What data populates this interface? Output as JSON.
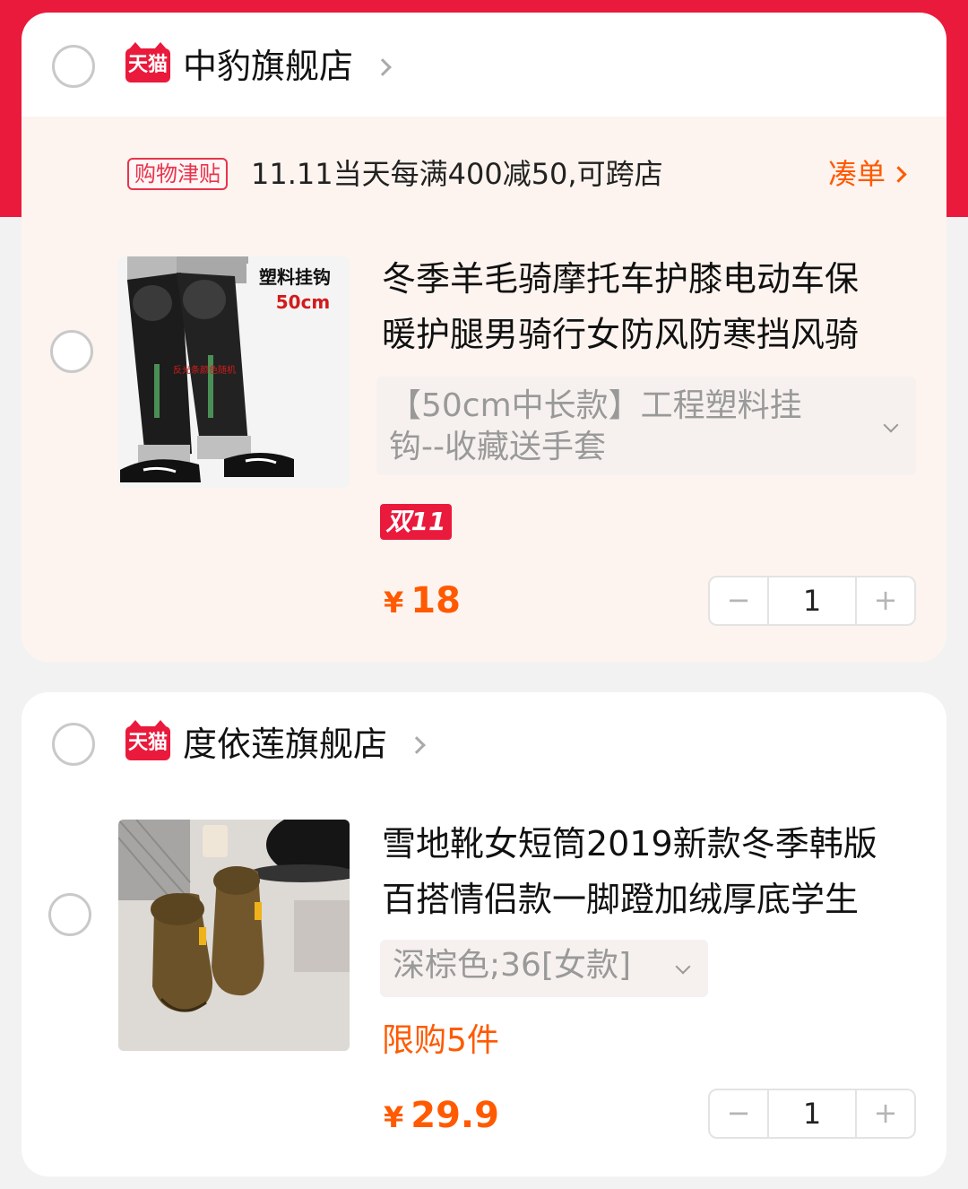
{
  "stores": [
    {
      "badge": "天猫",
      "name": "中豹旗舰店",
      "promo": {
        "tag": "购物津贴",
        "text": "11.11当天每满400减50,可跨店",
        "link": "凑单"
      },
      "item": {
        "title_line1": "冬季羊毛骑摩托车护膝电动车保",
        "title_line2": "暖护腿男骑行女防风防寒挡风骑",
        "sku": "【50cm中长款】工程塑料挂钩--收藏送手套",
        "image_caption_1": "塑料挂钩",
        "image_caption_2": "50cm",
        "image_caption_3": "反光条颜色随机",
        "event_badge": "双11",
        "currency": "¥",
        "price": "18",
        "quantity": "1"
      }
    },
    {
      "badge": "天猫",
      "name": "度依莲旗舰店",
      "item": {
        "title_line1": "雪地靴女短筒2019新款冬季韩版",
        "title_line2": "百搭情侣款一脚蹬加绒厚底学生",
        "sku": "深棕色;36[女款]",
        "limit": "限购5件",
        "currency": "¥",
        "price": "29.9",
        "quantity": "1"
      }
    }
  ],
  "stepper": {
    "minus": "−",
    "plus": "+"
  },
  "colors": {
    "header_red": "#ea1a3c",
    "price_orange": "#ff5a00",
    "promo_bg": "#fdf4ef"
  }
}
